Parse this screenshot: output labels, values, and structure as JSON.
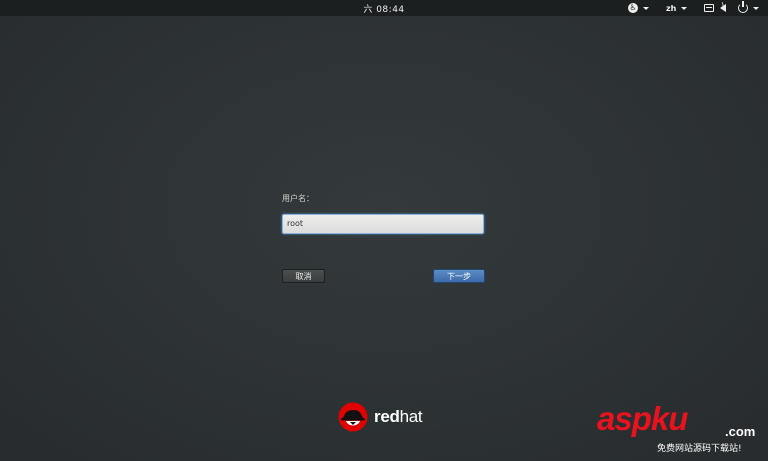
{
  "topbar": {
    "clock": "六 08:44",
    "language": "zh"
  },
  "login": {
    "username_label": "用户名：",
    "username_value": "root",
    "cancel_label": "取消",
    "next_label": "下一步"
  },
  "branding": {
    "logo_red": "red",
    "logo_hat": "hat"
  },
  "watermark": {
    "main": "aspku",
    "dotcom": ".com",
    "subtitle": "免费网站源码下载站!"
  },
  "colors": {
    "accent": "#3d6aa8",
    "background": "#2e3436",
    "watermark_red": "#e8131f"
  }
}
